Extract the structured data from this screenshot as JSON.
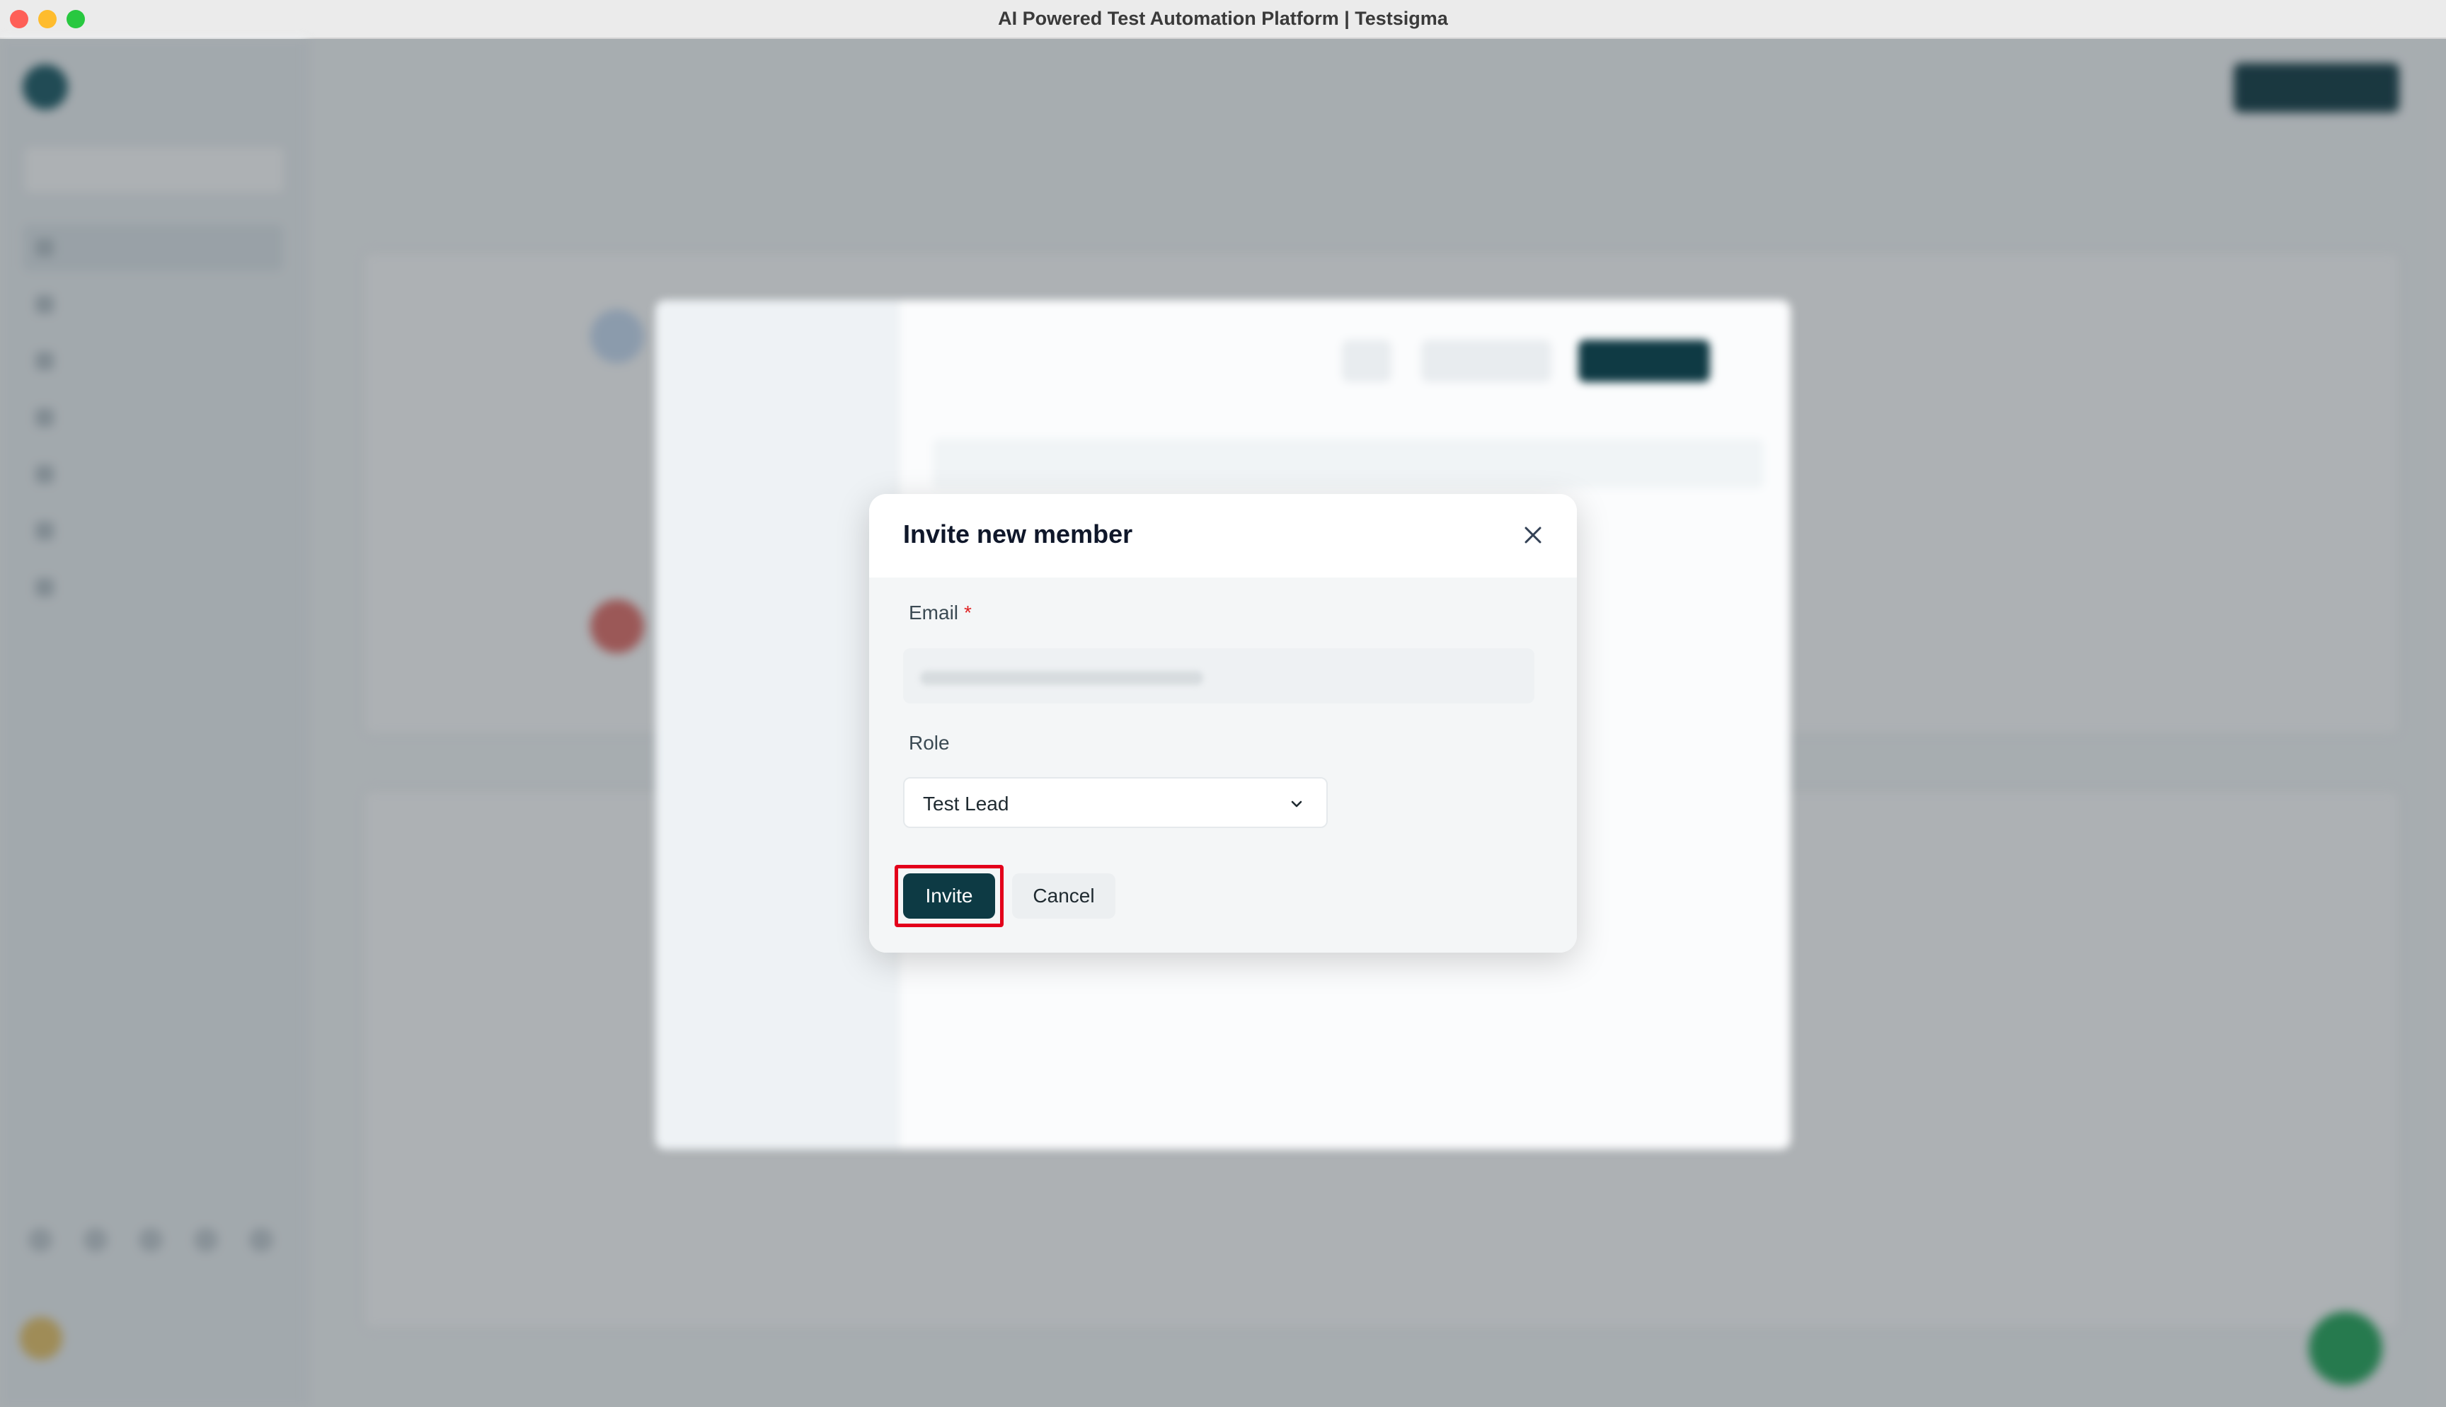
{
  "window": {
    "title": "AI Powered Test Automation Platform | Testsigma"
  },
  "dialog": {
    "title": "Invite new member",
    "email_label": "Email",
    "email_required_marker": "*",
    "email_value": "",
    "role_label": "Role",
    "role_value": "Test Lead",
    "invite_label": "Invite",
    "cancel_label": "Cancel"
  },
  "colors": {
    "primary_button": "#0d3a44",
    "highlight_outline": "#e3001b",
    "required_star": "#e02424"
  }
}
